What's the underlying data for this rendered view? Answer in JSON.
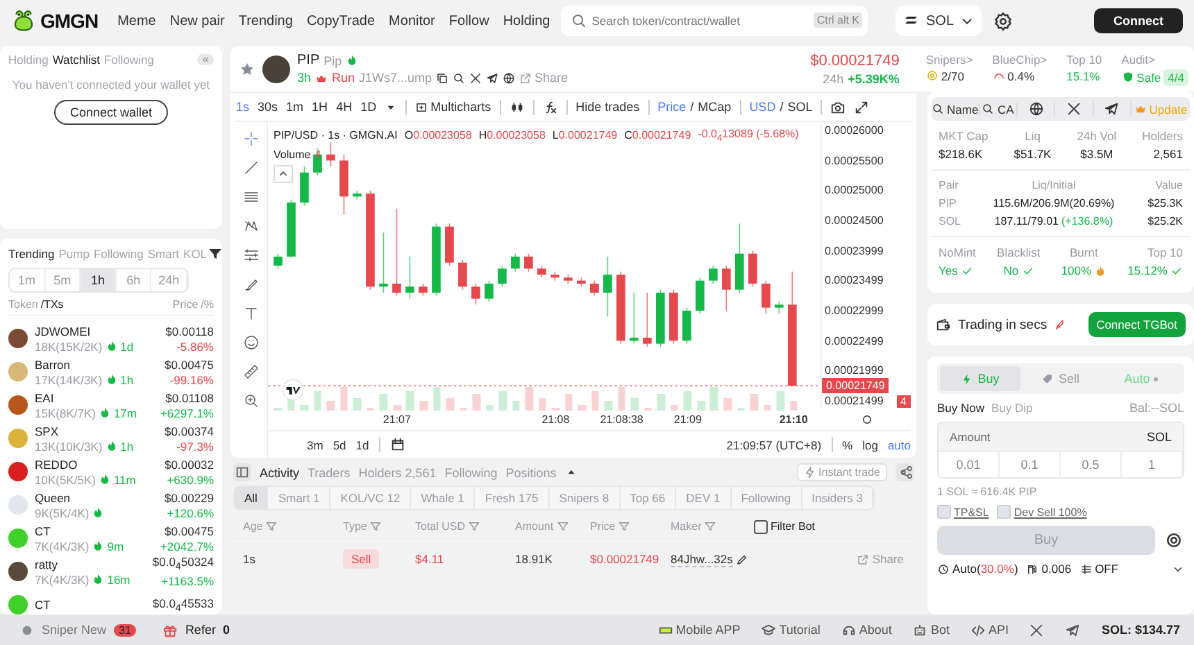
{
  "topbar": {
    "logo": "GMGN",
    "nav": [
      "Meme",
      "New pair",
      "Trending",
      "CopyTrade",
      "Monitor",
      "Follow",
      "Holding"
    ],
    "search": {
      "placeholder": "Search token/contract/wallet",
      "shortcut": "Ctrl alt K"
    },
    "chain": "SOL",
    "connect": "Connect"
  },
  "watchlist": {
    "tabs": [
      {
        "label": "Holding",
        "selected": false
      },
      {
        "label": "Watchlist",
        "selected": true
      },
      {
        "label": "Following",
        "selected": false
      }
    ],
    "message": "You haven't connected your wallet yet",
    "button": "Connect wallet"
  },
  "trending": {
    "tabs": [
      {
        "label": "Trending",
        "selected": true
      },
      {
        "label": "Pump",
        "selected": false
      },
      {
        "label": "Following",
        "selected": false
      },
      {
        "label": "Smart",
        "selected": false
      },
      {
        "label": "KOL",
        "selected": false
      }
    ],
    "intervals": [
      {
        "label": "1m",
        "selected": false
      },
      {
        "label": "5m",
        "selected": false
      },
      {
        "label": "1h",
        "selected": true
      },
      {
        "label": "6h",
        "selected": false
      },
      {
        "label": "24h",
        "selected": false
      }
    ],
    "columns": {
      "token": "Token",
      "txs": "/TXs",
      "price": "Price",
      "change": "/%"
    },
    "rows": [
      {
        "name": "JDWOMEI",
        "txs": "18K(15K/2K)",
        "age": "1d",
        "price": "$0.00118",
        "change": "-5.86%",
        "up": false,
        "color": "#7a4a32"
      },
      {
        "name": "Barron",
        "txs": "17K(14K/3K)",
        "age": "1h",
        "price": "$0.00475",
        "change": "-99.16%",
        "up": false,
        "color": "#d8b878"
      },
      {
        "name": "EAI",
        "txs": "15K(8K/7K)",
        "age": "17m",
        "price": "$0.01108",
        "change": "+6297.1%",
        "up": true,
        "color": "#b8561c"
      },
      {
        "name": "SPX",
        "txs": "13K(10K/3K)",
        "age": "1h",
        "price": "$0.00374",
        "change": "-97.3%",
        "up": false,
        "color": "#d9b23a"
      },
      {
        "name": "REDDO",
        "txs": "10K(5K/5K)",
        "age": "11m",
        "price": "$0.00032",
        "change": "+630.9%",
        "up": true,
        "color": "#d81e1e"
      },
      {
        "name": "Queen",
        "txs": "9K(5K/4K)",
        "price": "$0.00229",
        "change": "+120.6%",
        "up": true,
        "color": "#e4e6ee"
      },
      {
        "name": "CT",
        "txs": "7K(4K/3K)",
        "age": "9m",
        "price": "$0.00475",
        "change": "+2042.7%",
        "up": true,
        "color": "#3fd12a"
      },
      {
        "name": "ratty",
        "txs": "7K(4K/3K)",
        "age": "16m",
        "price": "$0.0$_{4}$50324",
        "change": "+1163.5%",
        "up": true,
        "color": "#5a4a3a"
      },
      {
        "name": "CT",
        "price": "$0.0$_{4}$45533",
        "color": "#3fd12a"
      }
    ]
  },
  "token": {
    "name": "PIP",
    "symbol": "Pip",
    "age": "3h",
    "status": "Run",
    "address": "J1Ws7...ump",
    "share": "Share",
    "price": "$0.00021749",
    "change_label": "24h",
    "change": "+5.39K%",
    "stats": [
      {
        "label": "Snipers>",
        "value": "2/70",
        "kind": "snipers"
      },
      {
        "label": "BlueChip>",
        "value": "0.4%",
        "kind": "bluechip"
      },
      {
        "label": "Top 10",
        "value": "15.1%",
        "kind": "plain"
      },
      {
        "label": "Audit>",
        "value": "Safe",
        "badge": "4/4",
        "kind": "audit"
      }
    ]
  },
  "chart": {
    "intervals": [
      {
        "label": "1s",
        "selected": true
      },
      {
        "label": "30s",
        "selected": false
      },
      {
        "label": "1m",
        "selected": false
      },
      {
        "label": "1H",
        "selected": false
      },
      {
        "label": "4H",
        "selected": false
      },
      {
        "label": "1D",
        "selected": false
      }
    ],
    "multicharts": "Multicharts",
    "hide_trades": "Hide trades",
    "price_mode": [
      {
        "label": "Price",
        "selected": true
      },
      {
        "label": "MCap",
        "selected": false
      }
    ],
    "price_mode_separator": "/",
    "currency": [
      {
        "label": "USD",
        "selected": true
      },
      {
        "label": "SOL",
        "selected": false
      }
    ],
    "currency_separator": "/",
    "legend": {
      "title": "PIP/USD · 1s · GMGN.AI",
      "ohlc": [
        {
          "key": "O",
          "value": "0.00023058"
        },
        {
          "key": "H",
          "value": "0.00023058"
        },
        {
          "key": "L",
          "value": "0.00021749"
        },
        {
          "key": "C",
          "value": "0.00021749"
        }
      ],
      "change": "-0.0$_{4}$13089 (-5.68%)"
    },
    "volume": {
      "label": "Volume",
      "value": "4"
    },
    "last_price": "0.00021749",
    "last_volume": "4",
    "chart_data": {
      "type": "candlestick",
      "ylim": [
        0.0002136,
        0.0002614
      ],
      "yticks": [
        {
          "value": 0.00026,
          "label": "0.00026000"
        },
        {
          "value": 0.000255,
          "label": "0.00025500"
        },
        {
          "value": 0.00025,
          "label": "0.00025000"
        },
        {
          "value": 0.000245,
          "label": "0.00024500"
        },
        {
          "value": 0.00023999,
          "label": "0.00023999"
        },
        {
          "value": 0.00023499,
          "label": "0.00023499"
        },
        {
          "value": 0.00022999,
          "label": "0.00022999"
        },
        {
          "value": 0.00022499,
          "label": "0.00022499"
        },
        {
          "value": 0.00021999,
          "label": "0.00021999"
        },
        {
          "value": 0.00021499,
          "label": "0.00021499"
        }
      ],
      "ref_lines": [
        {
          "axis": "y",
          "value": 0.00021749
        }
      ],
      "categories": [
        null,
        null,
        null,
        null,
        null,
        null,
        null,
        null,
        null,
        "21:07",
        null,
        null,
        null,
        null,
        null,
        null,
        null,
        null,
        null,
        null,
        null,
        "21:08",
        null,
        null,
        null,
        null,
        "21:08:38",
        null,
        null,
        null,
        null,
        "21:09",
        null,
        null,
        null,
        null,
        null,
        null,
        null,
        "21:10"
      ],
      "ohlc": [
        [
          0.0002375,
          0.0002395,
          0.000237,
          0.000239
        ],
        [
          0.000239,
          0.0002485,
          0.0002388,
          0.000248
        ],
        [
          0.000248,
          0.000254,
          0.0002475,
          0.000253
        ],
        [
          0.000253,
          0.000257,
          0.0002525,
          0.000256
        ],
        [
          0.000256,
          0.000258,
          0.000254,
          0.000255
        ],
        [
          0.000255,
          0.000256,
          0.000246,
          0.000249
        ],
        [
          0.000249,
          0.00025,
          0.0002485,
          0.0002495
        ],
        [
          0.0002495,
          0.00025,
          0.0002335,
          0.000234
        ],
        [
          0.000234,
          0.000243,
          0.000233,
          0.0002345
        ],
        [
          0.0002345,
          0.000247,
          0.0002325,
          0.000233
        ],
        [
          0.000233,
          0.000239,
          0.000232,
          0.000234
        ],
        [
          0.000234,
          0.0002345,
          0.0002325,
          0.000233
        ],
        [
          0.000233,
          0.0002445,
          0.0002325,
          0.000244
        ],
        [
          0.000244,
          0.0002445,
          0.0002375,
          0.000238
        ],
        [
          0.000238,
          0.0002385,
          0.0002335,
          0.000234
        ],
        [
          0.000234,
          0.0002345,
          0.000231,
          0.000232
        ],
        [
          0.000232,
          0.000235,
          0.0002315,
          0.0002345
        ],
        [
          0.0002345,
          0.0002375,
          0.000234,
          0.000237
        ],
        [
          0.000237,
          0.0002395,
          0.0002365,
          0.000239
        ],
        [
          0.000239,
          0.0002395,
          0.0002365,
          0.000237
        ],
        [
          0.000237,
          0.0002375,
          0.0002355,
          0.000236
        ],
        [
          0.000236,
          0.0002365,
          0.000235,
          0.0002355
        ],
        [
          0.0002355,
          0.000236,
          0.0002345,
          0.000235
        ],
        [
          0.000235,
          0.0002355,
          0.000234,
          0.0002345
        ],
        [
          0.0002345,
          0.000235,
          0.0002325,
          0.000233
        ],
        [
          0.000233,
          0.000239,
          0.000229,
          0.000236
        ],
        [
          0.000236,
          0.0002365,
          0.0002245,
          0.000225
        ],
        [
          0.000225,
          0.000233,
          0.0002245,
          0.0002255
        ],
        [
          0.0002255,
          0.000233,
          0.000224,
          0.0002245
        ],
        [
          0.0002245,
          0.0002335,
          0.000224,
          0.000233
        ],
        [
          0.000233,
          0.0002335,
          0.0002245,
          0.000225
        ],
        [
          0.000225,
          0.0002305,
          0.0002245,
          0.00023
        ],
        [
          0.00023,
          0.0002355,
          0.0002295,
          0.000235
        ],
        [
          0.000235,
          0.0002375,
          0.0002345,
          0.000237
        ],
        [
          0.000237,
          0.0002375,
          0.00023,
          0.0002335
        ],
        [
          0.0002335,
          0.0002445,
          0.000233,
          0.0002395
        ],
        [
          0.0002395,
          0.00024,
          0.000234,
          0.0002345
        ],
        [
          0.0002345,
          0.000235,
          0.0002295,
          0.0002305
        ],
        [
          0.0002305,
          0.0002315,
          0.0002295,
          0.000231
        ],
        [
          0.000231,
          0.0002365,
          0.00021749,
          0.00021749
        ]
      ]
    },
    "last_tick_bold": true,
    "ranges": [
      "3m",
      "5d",
      "1d"
    ],
    "clock": "21:09:57 (UTC+8)",
    "scale": [
      {
        "label": "%",
        "selected": false
      },
      {
        "label": "log",
        "selected": false
      },
      {
        "label": "auto",
        "selected": true
      }
    ]
  },
  "activity": {
    "tabs": [
      {
        "label": "Activity",
        "selected": true
      },
      {
        "label": "Traders",
        "selected": false
      },
      {
        "label": "Holders 2,561",
        "selected": false
      },
      {
        "label": "Following",
        "selected": false
      },
      {
        "label": "Positions",
        "selected": false
      }
    ],
    "instant_trade": "Instant trade",
    "filters": [
      {
        "label": "All",
        "selected": true
      },
      {
        "label": "Smart 1",
        "selected": false
      },
      {
        "label": "KOL/VC 12",
        "selected": false
      },
      {
        "label": "Whale 1",
        "selected": false
      },
      {
        "label": "Fresh 175",
        "selected": false
      },
      {
        "label": "Snipers 8",
        "selected": false
      },
      {
        "label": "Top 66",
        "selected": false
      },
      {
        "label": "DEV 1",
        "selected": false
      },
      {
        "label": "Following",
        "selected": false
      },
      {
        "label": "Insiders 3",
        "selected": false
      }
    ],
    "columns": [
      "Age",
      "Type",
      "Total USD",
      "Amount",
      "Price",
      "Maker"
    ],
    "filter_bot": {
      "label": "Filter Bot",
      "checked": false
    },
    "rows": [
      {
        "age": "1s",
        "type": "Sell",
        "kind": "sell",
        "total": "$4.11",
        "amount": "18.91K",
        "price": "$0.00021749",
        "maker": "84Jhw...32s",
        "share": "Share"
      }
    ]
  },
  "info": {
    "links": [
      {
        "label": "Name",
        "kind": "search"
      },
      {
        "label": "CA",
        "kind": "search"
      },
      {
        "kind": "globe"
      },
      {
        "kind": "x"
      },
      {
        "kind": "telegram"
      },
      {
        "label": "Update",
        "kind": "update"
      }
    ],
    "metrics": [
      {
        "label": "MKT Cap",
        "value": "$218.6K"
      },
      {
        "label": "Liq",
        "value": "$51.7K"
      },
      {
        "label": "24h Vol",
        "value": "$3.5M"
      },
      {
        "label": "Holders",
        "value": "2,561"
      }
    ],
    "pair": {
      "columns": [
        "Pair",
        "Liq/Initial",
        "Value"
      ],
      "rows": [
        {
          "pair": "PIP",
          "liq": "115.6M/206.9M(20.69%)",
          "value": "$25.3K"
        },
        {
          "pair": "SOL",
          "liq": "187.11/79.01",
          "gain": "(+136.8%)",
          "value": "$25.2K"
        }
      ]
    },
    "checks": [
      {
        "label": "NoMint",
        "value": "Yes",
        "kind": "ok"
      },
      {
        "label": "Blacklist",
        "value": "No",
        "kind": "ok"
      },
      {
        "label": "Burnt",
        "value": "100%",
        "kind": "fire"
      },
      {
        "label": "Top 10",
        "value": "15.12%",
        "kind": "ok"
      }
    ]
  },
  "tgbot": {
    "text": "Trading in secs",
    "button": "Connect TGBot"
  },
  "trade": {
    "sides": [
      {
        "label": "Buy",
        "selected": true,
        "kind": "buy"
      },
      {
        "label": "Sell",
        "selected": false,
        "kind": "sell"
      },
      {
        "label": "Auto",
        "selected": false,
        "kind": "auto"
      }
    ],
    "modes": [
      {
        "label": "Buy Now",
        "selected": true
      },
      {
        "label": "Buy Dip",
        "selected": false
      }
    ],
    "balance": "Bal:--SOL",
    "amount": {
      "placeholder": "Amount",
      "unit": "SOL"
    },
    "presets": [
      "0.01",
      "0.1",
      "0.5",
      "1"
    ],
    "rate": "1 SOL ≈ 616.4K PIP",
    "options": [
      {
        "label": "TP&SL",
        "checked": false
      },
      {
        "label": "Dev Sell 100%",
        "checked": false
      }
    ],
    "submit": {
      "label": "Buy",
      "disabled": true
    },
    "settings": [
      {
        "kind": "auto",
        "label": "Auto(",
        "value": "30.0%",
        "suffix": ")"
      },
      {
        "kind": "gas",
        "value": "0.006"
      },
      {
        "kind": "mev",
        "value": "OFF"
      }
    ]
  },
  "footer": {
    "sniper": {
      "label": "Sniper New",
      "count": "31"
    },
    "refer": {
      "label": "Refer",
      "count": "0"
    },
    "links": [
      {
        "label": "Mobile APP",
        "kind": "app"
      },
      {
        "label": "Tutorial",
        "kind": "tutorial"
      },
      {
        "label": "About",
        "kind": "about"
      },
      {
        "label": "Bot",
        "kind": "bot"
      },
      {
        "label": "API",
        "kind": "api"
      },
      {
        "kind": "x"
      },
      {
        "kind": "telegram"
      }
    ],
    "balance": "SOL: $134.77"
  }
}
